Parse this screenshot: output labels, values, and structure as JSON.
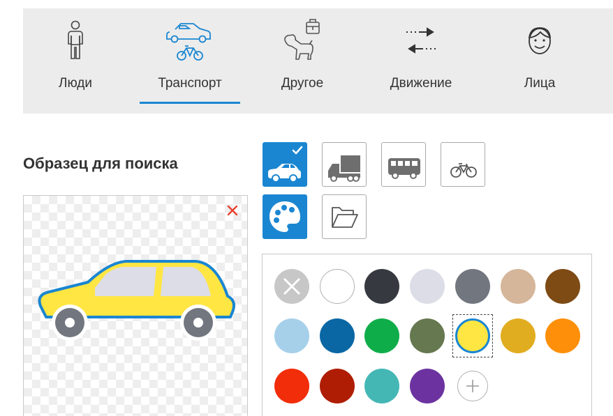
{
  "tabs": [
    {
      "label": "Люди",
      "icon": "person-icon",
      "active": false
    },
    {
      "label": "Транспорт",
      "icon": "car-bike-icon",
      "active": true
    },
    {
      "label": "Другое",
      "icon": "dog-luggage-icon",
      "active": false
    },
    {
      "label": "Движение",
      "icon": "motion-arrows-icon",
      "active": false
    },
    {
      "label": "Лица",
      "icon": "face-icon",
      "active": false
    }
  ],
  "sample": {
    "title": "Образец для поиска",
    "image": "yellow-car",
    "close_icon": "close-icon"
  },
  "vehicle_types": [
    {
      "name": "car",
      "icon": "car-icon",
      "selected": true
    },
    {
      "name": "truck",
      "icon": "truck-icon",
      "selected": false
    },
    {
      "name": "bus",
      "icon": "bus-icon",
      "selected": false
    },
    {
      "name": "bicycle",
      "icon": "bicycle-icon",
      "selected": false
    }
  ],
  "tools": [
    {
      "name": "color",
      "icon": "palette-icon",
      "active": true
    },
    {
      "name": "open-file",
      "icon": "folder-icon",
      "active": false
    }
  ],
  "colors": {
    "accent": "#1a86d1",
    "swatches": [
      [
        "none",
        "#ffffff",
        "#363a40",
        "#dcdde6",
        "#72767f",
        "#d5b69a",
        "#7e4b14"
      ],
      [
        "#a6d0ea",
        "#0a67a4",
        "#0fad4a",
        "#65784f",
        "#ffe642",
        "#e1ad20",
        "#fd8f0a"
      ],
      [
        "#f22d09",
        "#af1d05",
        "#44b7b5",
        "#6c33a0",
        "add"
      ]
    ],
    "selected": "#ffe642"
  }
}
